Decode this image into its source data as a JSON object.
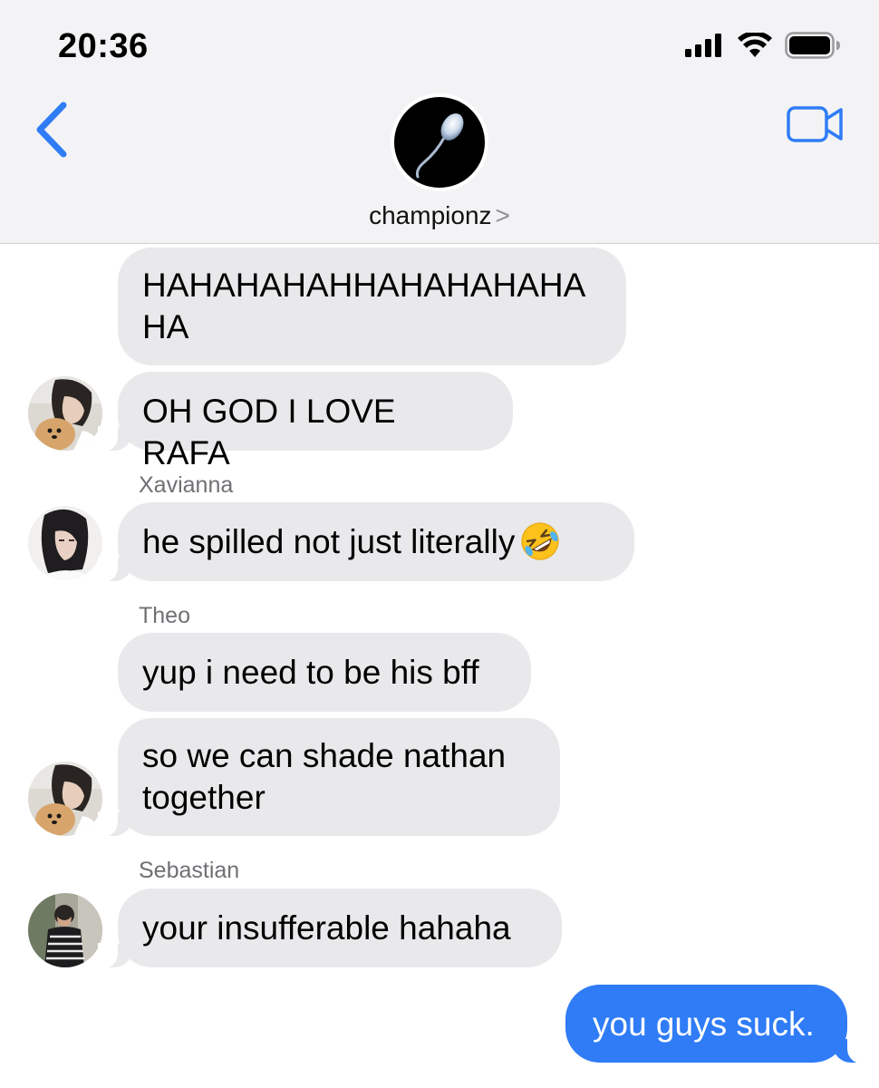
{
  "status_bar": {
    "time": "20:36",
    "icons": [
      "cellular-signal-icon",
      "wifi-icon",
      "battery-icon"
    ]
  },
  "header": {
    "back_icon": "chevron-left-icon",
    "video_icon": "video-camera-icon",
    "group_name": "championz",
    "group_chevron": ">",
    "group_avatar": "sperm-icon"
  },
  "colors": {
    "accent": "#2f7cf6",
    "received_bubble": "#e9e9eb",
    "header_bg": "#f3f3f5",
    "sender_name": "#707075"
  },
  "messages": [
    {
      "type": "received",
      "text": "HAHAHAHAHHAHAHAHAHA HA"
    },
    {
      "type": "received",
      "text": "OH GOD I LOVE RAFA"
    },
    {
      "type": "received",
      "sender": "Xavianna",
      "text": "he spilled not just literally",
      "emoji": "rolling-on-floor-laughing-emoji"
    },
    {
      "type": "received",
      "sender": "Theo",
      "text": "yup i need to be his bff"
    },
    {
      "type": "received",
      "text": "so we can shade nathan together"
    },
    {
      "type": "received",
      "sender": "Sebastian",
      "text": "your insufferable hahaha"
    },
    {
      "type": "sent",
      "text": "you guys suck."
    }
  ]
}
